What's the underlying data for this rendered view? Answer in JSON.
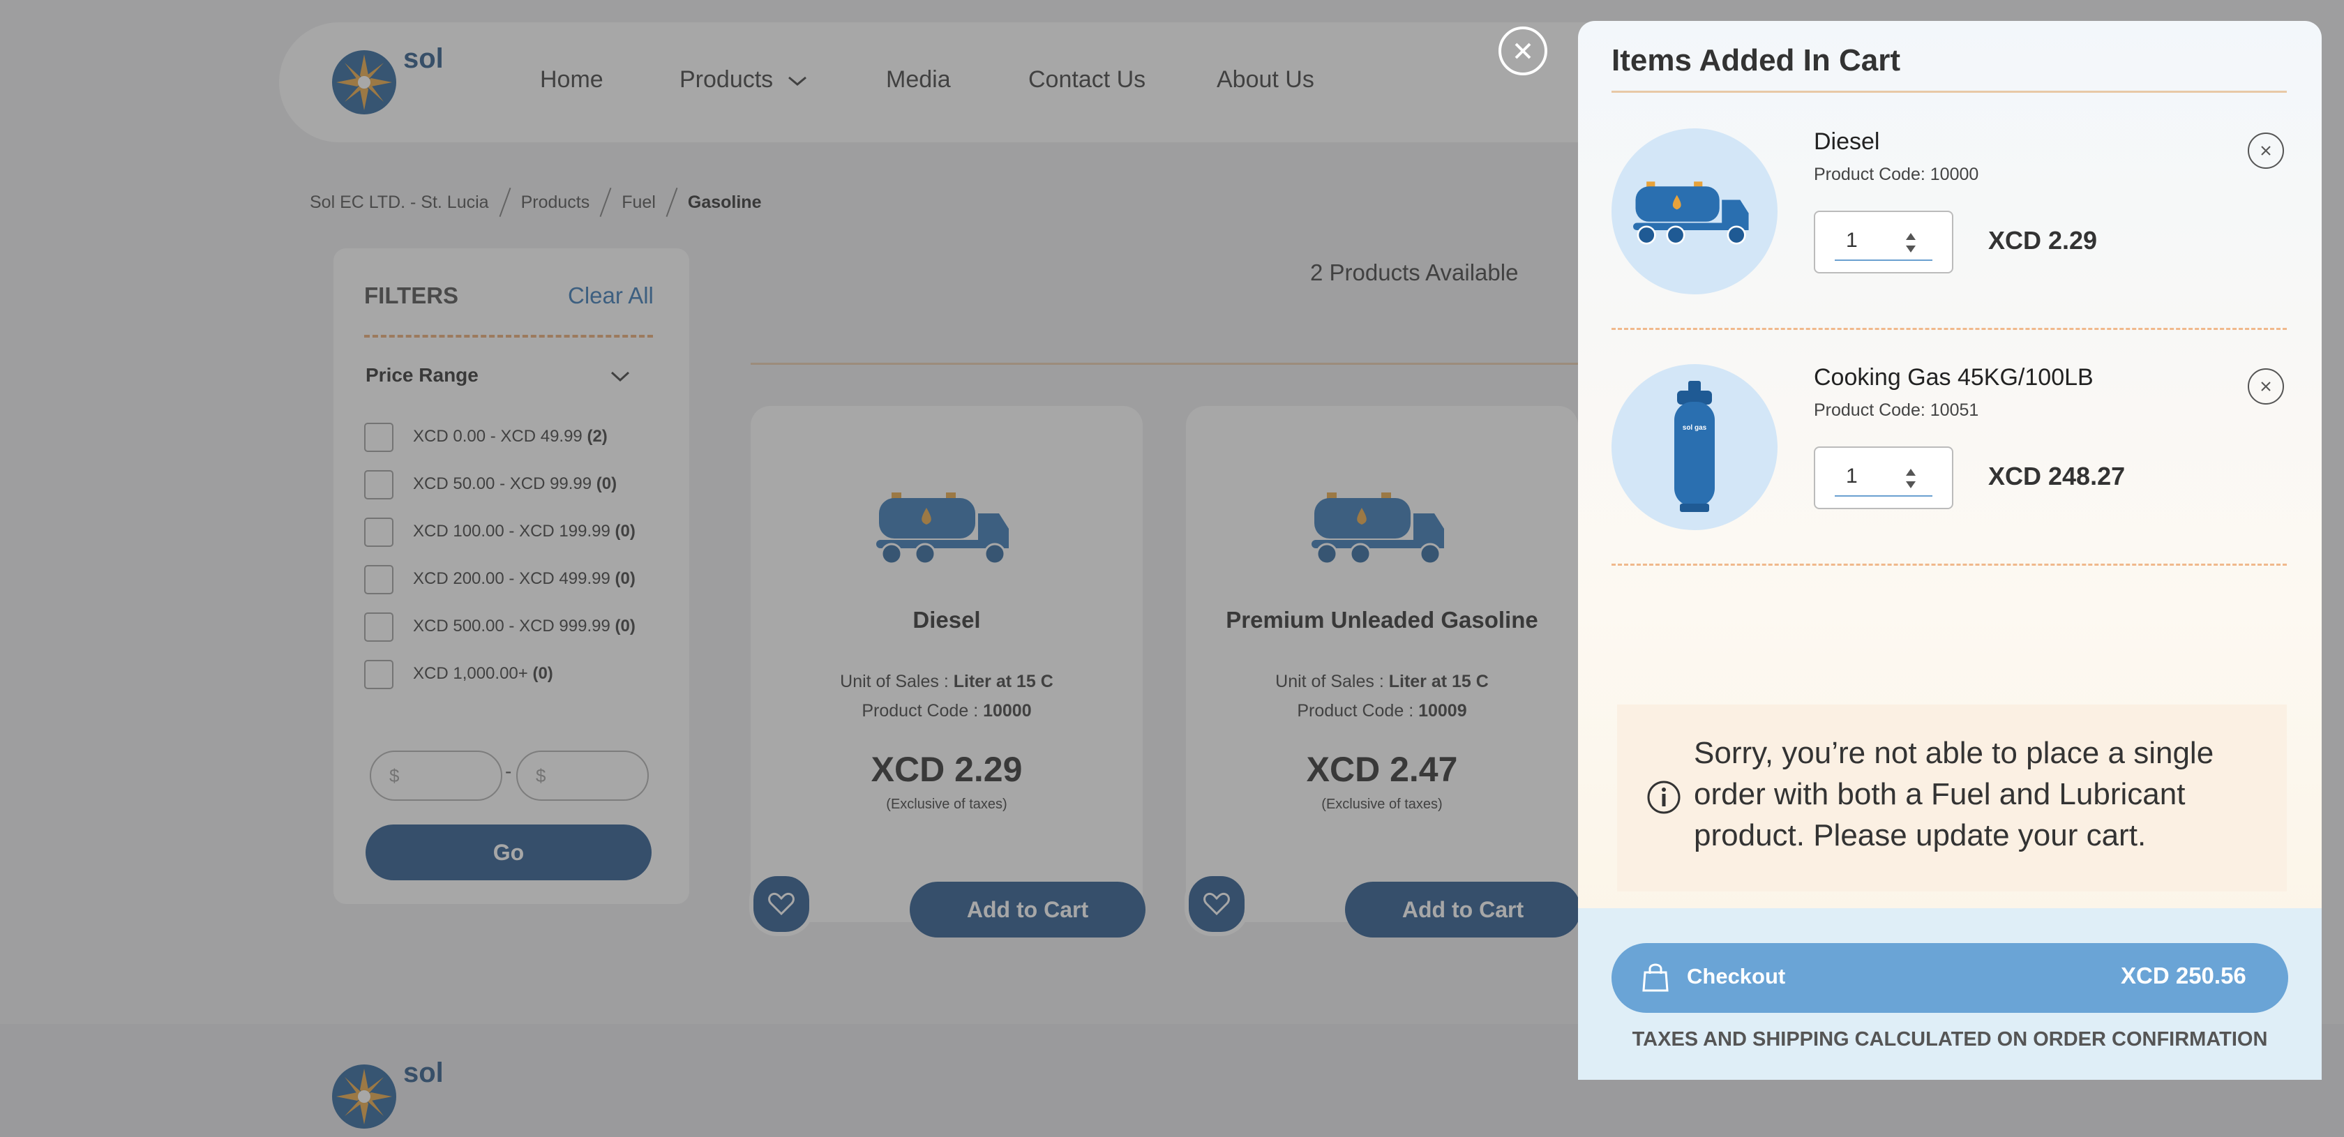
{
  "brand": {
    "name": "sol"
  },
  "nav": {
    "items": [
      "Home",
      "Products",
      "Media",
      "Contact Us",
      "About Us"
    ]
  },
  "breadcrumb": [
    "Sol EC LTD. - St. Lucia",
    "Products",
    "Fuel",
    "Gasoline"
  ],
  "filters": {
    "title": "FILTERS",
    "clear_all": "Clear All",
    "price_range_title": "Price Range",
    "ranges": [
      {
        "label": "XCD 0.00 - XCD 49.99",
        "count": "(2)"
      },
      {
        "label": "XCD 50.00 - XCD 99.99",
        "count": "(0)"
      },
      {
        "label": "XCD 100.00 - XCD 199.99",
        "count": "(0)"
      },
      {
        "label": "XCD 200.00 - XCD 499.99",
        "count": "(0)"
      },
      {
        "label": "XCD 500.00 - XCD 999.99",
        "count": "(0)"
      },
      {
        "label": "XCD 1,000.00+",
        "count": "(0)"
      }
    ],
    "min_placeholder": "$",
    "max_placeholder": "$",
    "range_dash": "-",
    "go_label": "Go"
  },
  "listing": {
    "available": "2 Products Available",
    "products": [
      {
        "name": "Diesel",
        "unit_label": "Unit of Sales : ",
        "unit": "Liter at 15 C",
        "code_label": "Product Code : ",
        "code": "10000",
        "price": "XCD 2.29",
        "note": "(Exclusive of taxes)",
        "add_label": "Add to Cart"
      },
      {
        "name": "Premium Unleaded Gasoline",
        "unit_label": "Unit of Sales : ",
        "unit": "Liter at 15 C",
        "code_label": "Product Code : ",
        "code": "10009",
        "price": "XCD 2.47",
        "note": "(Exclusive of taxes)",
        "add_label": "Add to Cart"
      }
    ]
  },
  "cart": {
    "title": "Items Added In Cart",
    "items": [
      {
        "name": "Diesel",
        "code": "Product Code: 10000",
        "qty": "1",
        "price": "XCD 2.29"
      },
      {
        "name": "Cooking Gas 45KG/100LB",
        "code": "Product Code: 10051",
        "qty": "1",
        "price": "XCD 248.27"
      }
    ],
    "warning": "Sorry, you’re not able to place a single order with both a Fuel and Lubricant product. Please update your cart.",
    "checkout_label": "Checkout",
    "total": "XCD 250.56",
    "taxes_note": "TAXES AND SHIPPING CALCULATED ON ORDER CONFIRMATION",
    "cylinder_text": "sol gas"
  },
  "colors": {
    "primary": "#1d4f86",
    "accent": "#e8a46a",
    "checkout": "#6aa4d6"
  }
}
